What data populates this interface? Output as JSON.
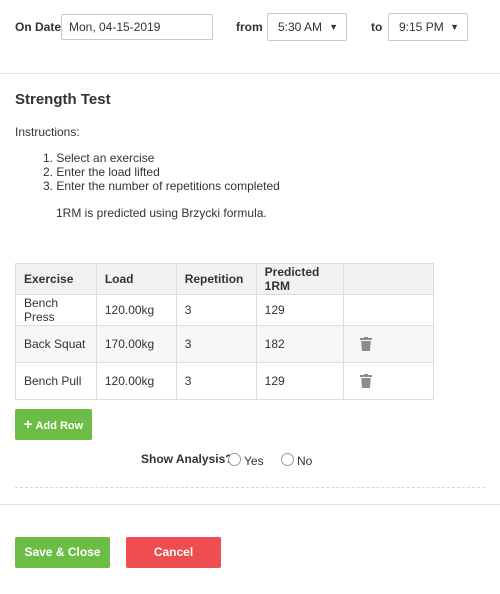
{
  "date_bar": {
    "on_date_label": "On Date",
    "date_value": "Mon, 04-15-2019",
    "from_label": "from",
    "from_value": "5:30 AM",
    "to_label": "to",
    "to_value": "9:15 PM"
  },
  "section": {
    "title": "Strength Test",
    "instructions_label": "Instructions:",
    "steps": [
      "1. Select an exercise",
      "2. Enter the load lifted",
      "3. Enter the number of repetitions completed"
    ],
    "formula_note": "1RM is predicted using Brzycki formula."
  },
  "table": {
    "headers": [
      "Exercise",
      "Load",
      "Repetition",
      "Predicted 1RM"
    ],
    "rows": [
      {
        "exercise": "Bench Press",
        "load": "120.00kg",
        "reps": "3",
        "predicted": "129"
      },
      {
        "exercise": "Back Squat",
        "load": "170.00kg",
        "reps": "3",
        "predicted": "182"
      },
      {
        "exercise": "Bench Pull",
        "load": "120.00kg",
        "reps": "3",
        "predicted": "129"
      }
    ]
  },
  "add_row_label": "Add Row",
  "analysis": {
    "label": "Show Analysis?",
    "yes_label": "Yes",
    "no_label": "No"
  },
  "footer": {
    "save_label": "Save & Close",
    "cancel_label": "Cancel"
  },
  "colors": {
    "green": "#6cbd45",
    "red": "#ef4d50",
    "trash_gray": "#8c8c8c"
  },
  "icons": {
    "delete": "trash-icon",
    "add": "plus-icon",
    "dropdown": "caret-down-icon"
  }
}
